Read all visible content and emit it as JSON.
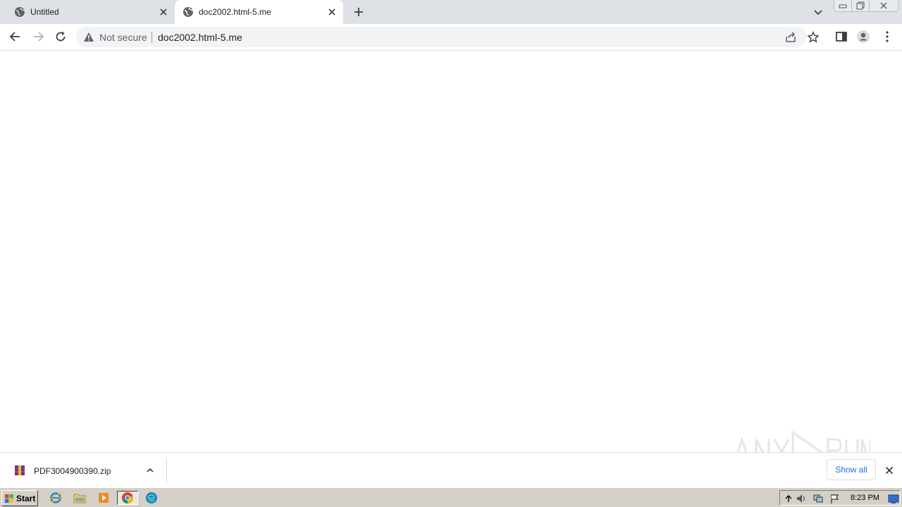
{
  "browser": {
    "tabs": [
      {
        "title": "Untitled",
        "active": false
      },
      {
        "title": "doc2002.html-5.me",
        "active": true
      }
    ],
    "address": {
      "security_label": "Not secure",
      "url": "doc2002.html-5.me"
    }
  },
  "downloads": {
    "file_name": "PDF3004900390.zip",
    "show_all_label": "Show all"
  },
  "taskbar": {
    "start_label": "Start",
    "clock": "8:23 PM"
  },
  "watermark_text": "ANY RUN",
  "colors": {
    "tabstrip": "#dee1e6",
    "omnibox": "#f1f3f4",
    "link_blue": "#1a73e8",
    "taskbar": "#d4d0c8"
  }
}
